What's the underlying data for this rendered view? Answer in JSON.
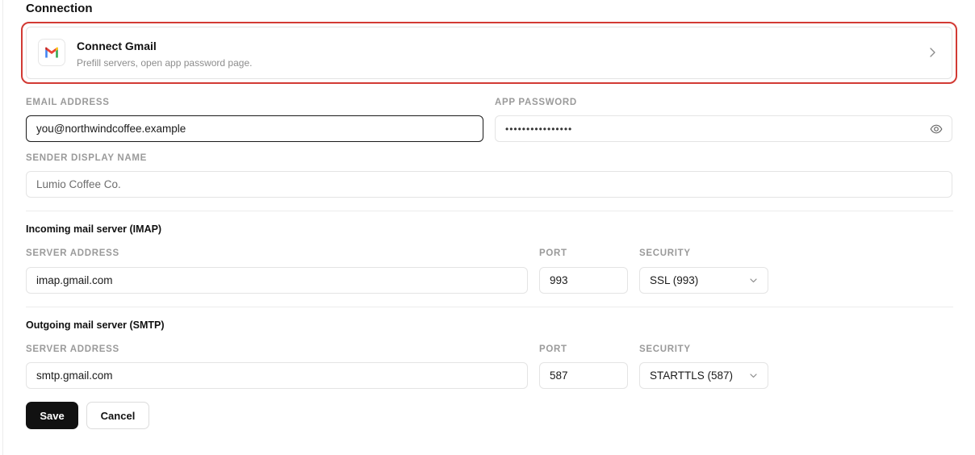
{
  "section": {
    "title": "Connection"
  },
  "gmail_card": {
    "title": "Connect Gmail",
    "subtitle": "Prefill servers, open app password page.",
    "logo_icon": "gmail-logo",
    "accent_border": "#d23a34"
  },
  "email": {
    "label": "EMAIL ADDRESS",
    "value": "you@northwindcoffee.example"
  },
  "app_password": {
    "label": "APP PASSWORD",
    "value": "••••••••••••••••",
    "toggle_icon": "eye-icon"
  },
  "sender": {
    "label": "SENDER DISPLAY NAME",
    "placeholder": "Lumio Coffee Co."
  },
  "imap": {
    "title": "Incoming mail server (IMAP)",
    "server_label": "SERVER ADDRESS",
    "server_value": "imap.gmail.com",
    "port_label": "PORT",
    "port_value": "993",
    "security_label": "SECURITY",
    "security_value": "SSL (993)"
  },
  "smtp": {
    "title": "Outgoing mail server (SMTP)",
    "server_label": "SERVER ADDRESS",
    "server_value": "smtp.gmail.com",
    "port_label": "PORT",
    "port_value": "587",
    "security_label": "SECURITY",
    "security_value": "STARTTLS (587)"
  },
  "actions": {
    "save_label": "Save",
    "cancel_label": "Cancel"
  }
}
